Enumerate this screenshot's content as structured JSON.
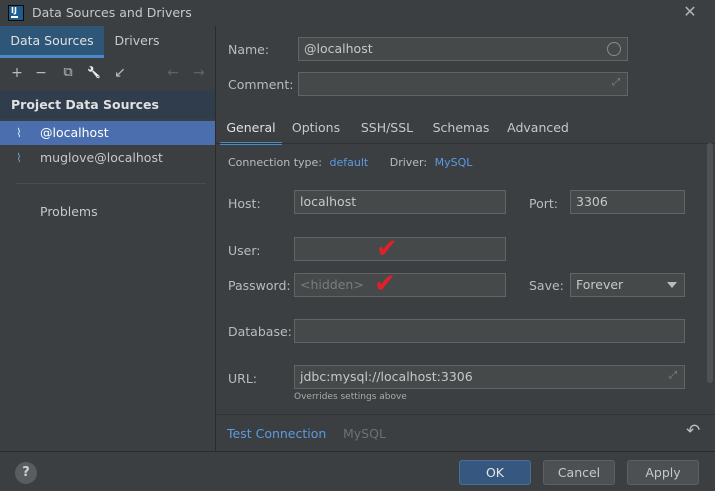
{
  "window": {
    "title": "Data Sources and Drivers",
    "logo_text": "IJ",
    "close_glyph": "✕"
  },
  "left": {
    "tabs": [
      {
        "label": "Data Sources",
        "active": true
      },
      {
        "label": "Drivers",
        "active": false
      }
    ],
    "toolbar": {
      "icons": [
        "add-icon",
        "remove-icon",
        "duplicate-icon",
        "wrench-icon",
        "import-icon",
        "back-arrow-icon",
        "forward-arrow-icon"
      ],
      "glyphs": {
        "add": "+",
        "remove": "−",
        "duplicate": "⧉",
        "wrench": "🔧",
        "import": "↙",
        "back": "←",
        "forward": "→"
      }
    },
    "section_header": "Project Data Sources",
    "data_sources": [
      {
        "label": "@localhost",
        "selected": true
      },
      {
        "label": "muglove@localhost",
        "selected": false
      }
    ],
    "ds_icon_glyph": "⌇",
    "problems": "Problems"
  },
  "form": {
    "name_label": "Name:",
    "name_value": "@localhost",
    "comment_label": "Comment:",
    "comment_value": "",
    "expand_glyph": "⤢"
  },
  "tabs": [
    {
      "label": "General",
      "active": true
    },
    {
      "label": "Options",
      "active": false
    },
    {
      "label": "SSH/SSL",
      "active": false
    },
    {
      "label": "Schemas",
      "active": false
    },
    {
      "label": "Advanced",
      "active": false
    }
  ],
  "general": {
    "connection_type_label": "Connection type:",
    "connection_type_value": "default",
    "driver_label": "Driver:",
    "driver_value": "MySQL",
    "host_label": "Host:",
    "host_value": "localhost",
    "port_label": "Port:",
    "port_value": "3306",
    "user_label": "User:",
    "user_value": "",
    "password_label": "Password:",
    "password_placeholder": "<hidden>",
    "save_label": "Save:",
    "save_value": "Forever",
    "database_label": "Database:",
    "database_value": "",
    "url_label": "URL:",
    "url_value": "jdbc:mysql://localhost:3306",
    "url_note": "Overrides settings above",
    "checkmark_glyph": "✔"
  },
  "bottom": {
    "test_connection": "Test Connection",
    "driver_name": "MySQL",
    "revert_glyph": "↶"
  },
  "footer": {
    "help": "?",
    "ok": "OK",
    "cancel": "Cancel",
    "apply": "Apply"
  },
  "colors": {
    "accent": "#4a88c7",
    "selection": "#4b6eaf",
    "link": "#5c9ae0",
    "check": "#e0202a",
    "primary_button": "#365880"
  }
}
